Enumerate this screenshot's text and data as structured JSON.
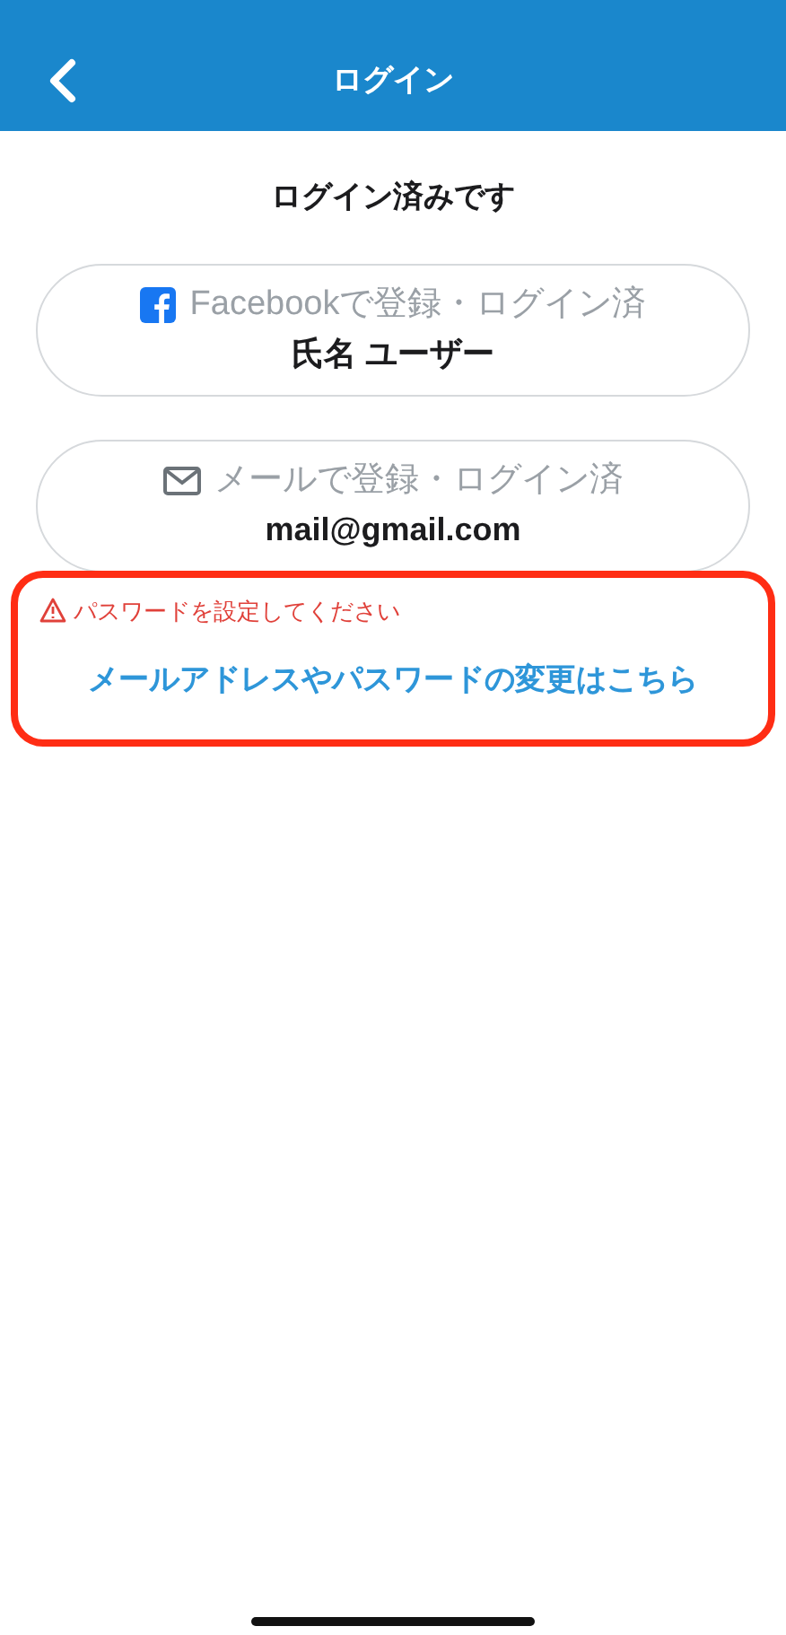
{
  "header": {
    "title": "ログイン"
  },
  "status_heading": "ログイン済みです",
  "accounts": [
    {
      "kind": "facebook",
      "label": "Facebookで登録・ログイン済",
      "value": "氏名 ユーザー",
      "disabled": true
    },
    {
      "kind": "mail",
      "label": "メールで登録・ログイン済",
      "value": "mail@gmail.com",
      "disabled": true
    }
  ],
  "warning": "パスワードを設定してください",
  "change_link": "メールアドレスやパスワードの変更はこちら",
  "highlighted": true
}
